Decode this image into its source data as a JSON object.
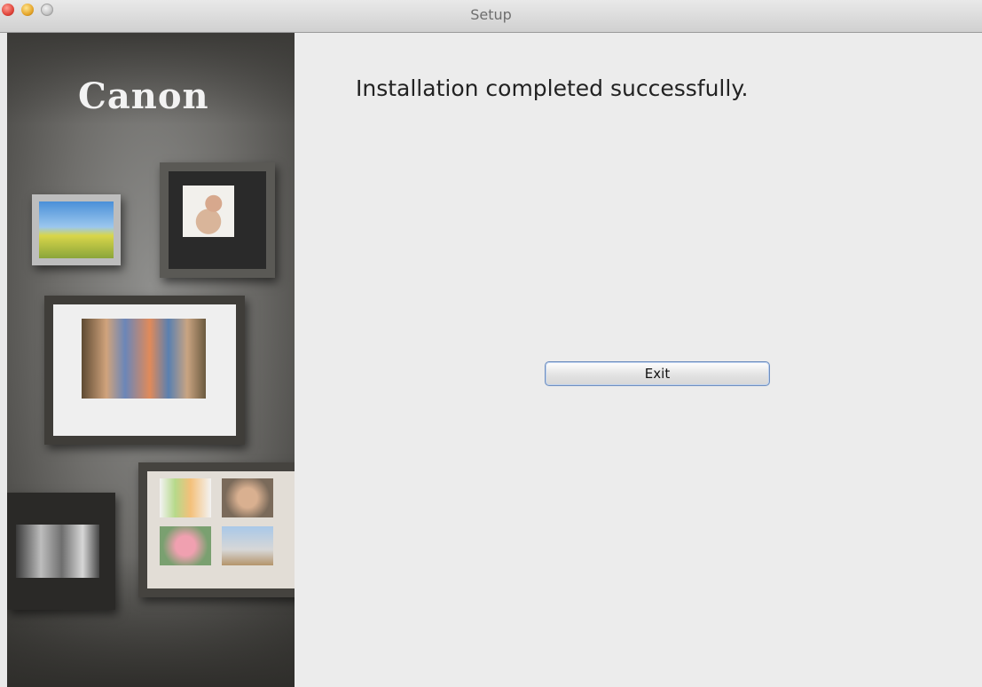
{
  "window": {
    "title": "Setup"
  },
  "sidebar": {
    "logo_text": "Canon"
  },
  "main": {
    "heading": "Installation completed successfully.",
    "exit_label": "Exit"
  },
  "colors": {
    "content_background": "#ececec",
    "button_border": "#6f8fbf"
  }
}
